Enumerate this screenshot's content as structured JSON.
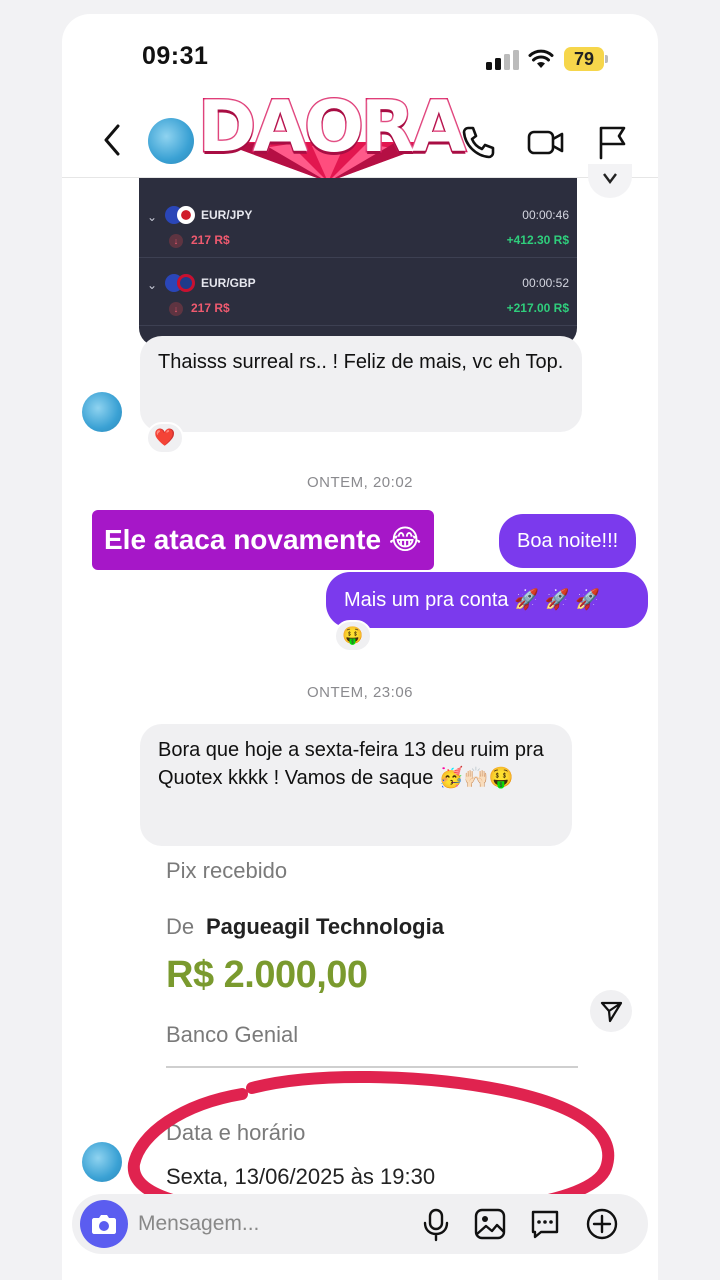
{
  "status_bar": {
    "time": "09:31",
    "battery": "79"
  },
  "header": {
    "sticker_text": "DAORA"
  },
  "trades": [
    {
      "pair": "EUR/JPY",
      "amount": "217 R$",
      "time": "00:00:46",
      "profit": "+412.30 R$"
    },
    {
      "pair": "EUR/GBP",
      "amount": "217 R$",
      "time": "00:00:52",
      "profit": "+217.00 R$"
    }
  ],
  "messages": {
    "msg1": {
      "text": "Thaisss surreal rs.. ! Feliz de mais, vc eh Top.",
      "reaction": "❤️"
    },
    "timestamp1": "ONTEM, 20:02",
    "caption": "Ele ataca novamente 😂",
    "out1": "Boa noite!!!",
    "out2": "Mais um pra conta 🚀 🚀 🚀",
    "out2_reaction": "🤑",
    "timestamp2": "ONTEM, 23:06",
    "msg2": {
      "text": "Bora que hoje a sexta-feira 13 deu ruim pra Quotex kkkk ! Vamos de saque 🥳🙌🏻🤑"
    }
  },
  "pix": {
    "title": "Pix recebido",
    "from_label": "De",
    "from_name": "Pagueagil Technologia",
    "amount": "R$ 2.000,00",
    "bank": "Banco Genial",
    "date_label": "Data e horário",
    "date_value": "Sexta, 13/06/2025 às 19:30"
  },
  "composer": {
    "placeholder": "Mensagem..."
  },
  "colors": {
    "accent": "#7b3aed",
    "caption_bg": "#a617c8",
    "camera": "#5b5df0",
    "pix_amount": "#7a9a2e",
    "circle": "#e0234f"
  },
  "icons": [
    "back-icon",
    "phone-icon",
    "video-icon",
    "flag-icon",
    "camera-icon",
    "mic-icon",
    "gallery-icon",
    "sticker-icon",
    "plus-icon",
    "send-icon"
  ]
}
